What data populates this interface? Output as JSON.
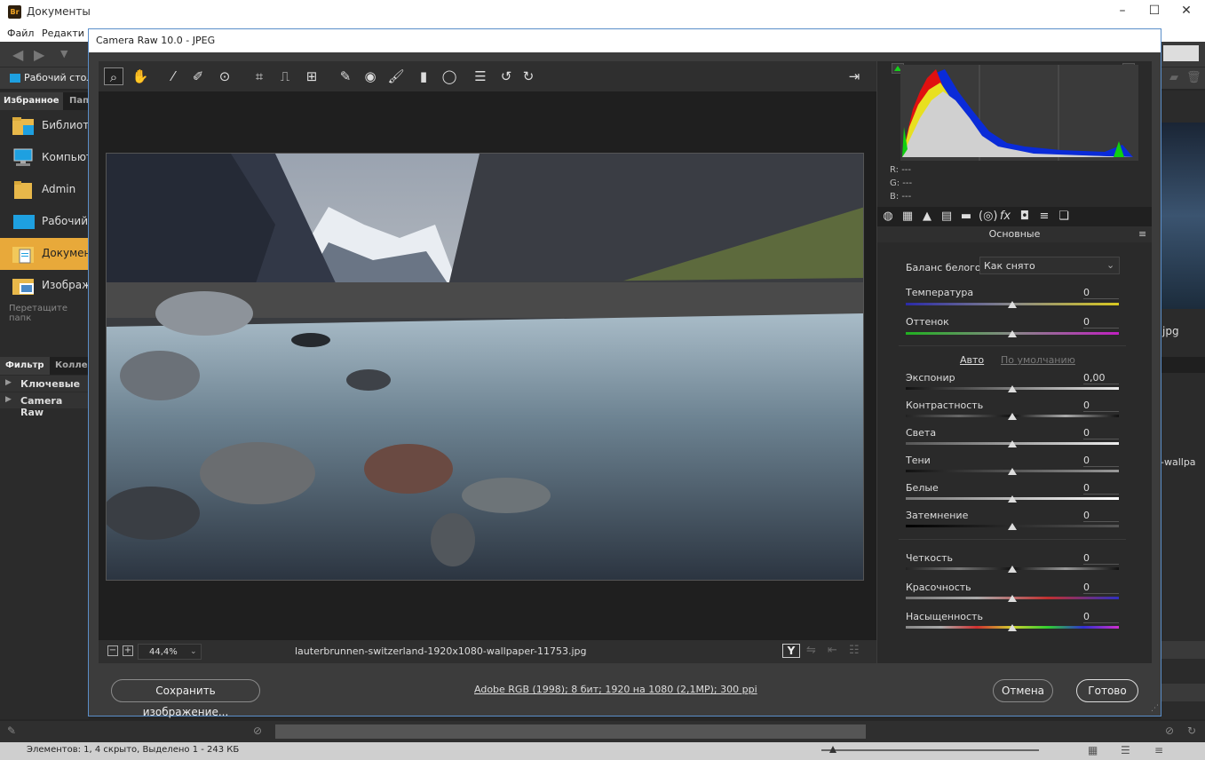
{
  "bridge": {
    "title": "Документы",
    "menu": [
      "Файл",
      "Редакти"
    ],
    "path_label": "Рабочий стол",
    "favorites_tabs": [
      "Избранное",
      "Пап"
    ],
    "favorites": [
      "Библиот",
      "Компьют",
      "Admin",
      "Рабочий",
      "Документ",
      "Изображ"
    ],
    "drop_hint": "Перетащите папк",
    "filter_tabs": [
      "Фильтр",
      "Коллек"
    ],
    "filter_items": [
      "Ключевые сл",
      "Camera Raw"
    ],
    "right_labels": [
      "jpg",
      "-wallpa"
    ],
    "status": "Элементов: 1, 4 скрыто, Выделено 1 - 243 КБ"
  },
  "dialog": {
    "title": "Camera Raw 10.0  -  JPEG",
    "zoom": "44,4%",
    "filename": "lauterbrunnen-switzerland-1920x1080-wallpaper-11753.jpg",
    "save_label": "Сохранить изображение...",
    "workflow_info": "Adobe RGB (1998); 8 бит; 1920 на 1080 (2,1МР); 300 ppi",
    "cancel_label": "Отмена",
    "done_label": "Готово"
  },
  "histogram": {
    "r": "R:   ---",
    "g": "G:   ---",
    "b": "B:   ---"
  },
  "panel": {
    "title": "Основные",
    "wb_label": "Баланс белого:",
    "wb_value": "Как снято",
    "auto": "Авто",
    "default": "По умолчанию",
    "sliders": [
      {
        "label": "Температура",
        "value": "0"
      },
      {
        "label": "Оттенок",
        "value": "0"
      },
      {
        "label": "Экспонир",
        "value": "0,00"
      },
      {
        "label": "Контрастность",
        "value": "0"
      },
      {
        "label": "Света",
        "value": "0"
      },
      {
        "label": "Тени",
        "value": "0"
      },
      {
        "label": "Белые",
        "value": "0"
      },
      {
        "label": "Затемнение",
        "value": "0"
      },
      {
        "label": "Четкость",
        "value": "0"
      },
      {
        "label": "Красочность",
        "value": "0"
      },
      {
        "label": "Насыщенность",
        "value": "0"
      }
    ]
  },
  "colors": {
    "accent": "#5a8ec9",
    "folder": "#e8b84a",
    "selected": "#e8a93a"
  }
}
